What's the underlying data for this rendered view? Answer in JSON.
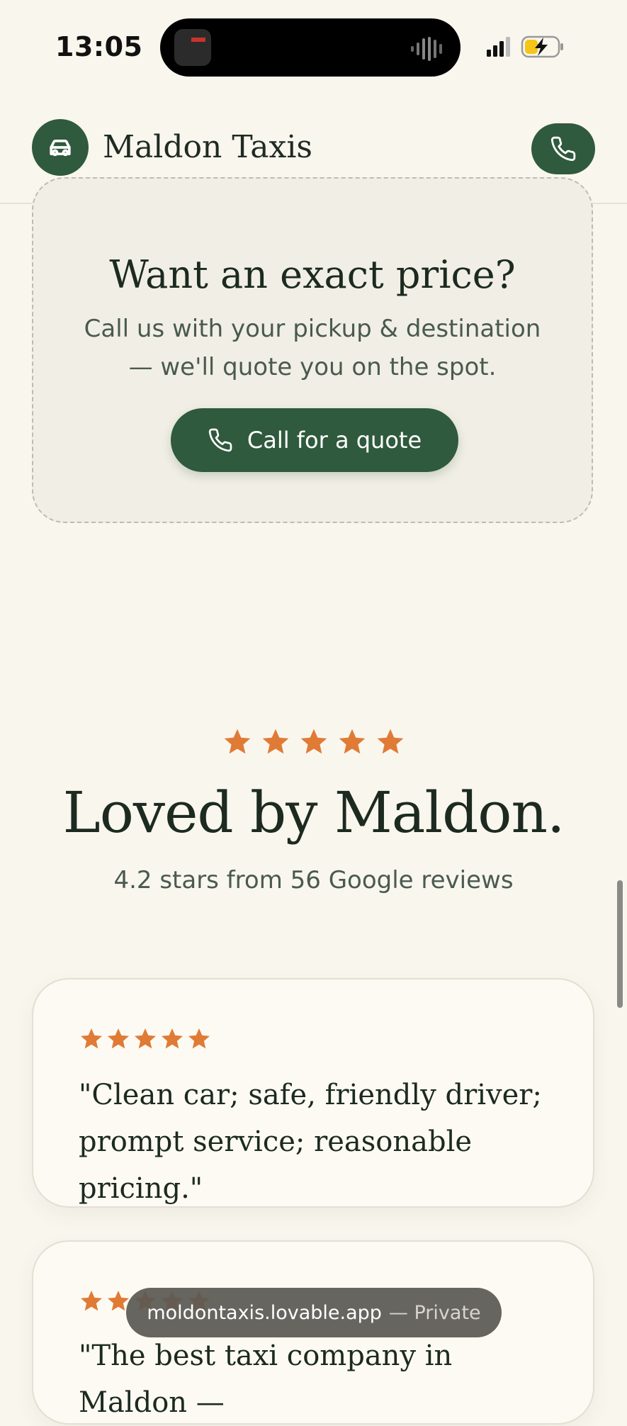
{
  "status_bar": {
    "time": "13:05"
  },
  "header": {
    "brand": "Maldon Taxis",
    "logo_icon": "car-icon",
    "call_icon": "phone-icon"
  },
  "quote_card": {
    "title": "Want an exact price?",
    "text": "Call us with your pickup & destination — we'll quote you on the spot.",
    "button_label": "Call for a quote",
    "button_icon": "phone-icon"
  },
  "reviews": {
    "rating_stars": 5,
    "title": "Loved by Maldon.",
    "subtitle": "4.2 stars from 56 Google reviews",
    "items": [
      {
        "stars": 5,
        "quote": "\"Clean car; safe, friendly driver; prompt service; reasonable pricing.\""
      },
      {
        "stars": 5,
        "quote": "\"The best taxi company in Maldon —"
      }
    ]
  },
  "browser": {
    "url": "moldontaxis.lovable.app",
    "mode": "— Private"
  },
  "colors": {
    "background": "#f9f6ee",
    "primary_green": "#2f5a3d",
    "star_orange": "#e07b35",
    "text_dark": "#1c2a20",
    "text_muted": "#4a5a4e"
  }
}
